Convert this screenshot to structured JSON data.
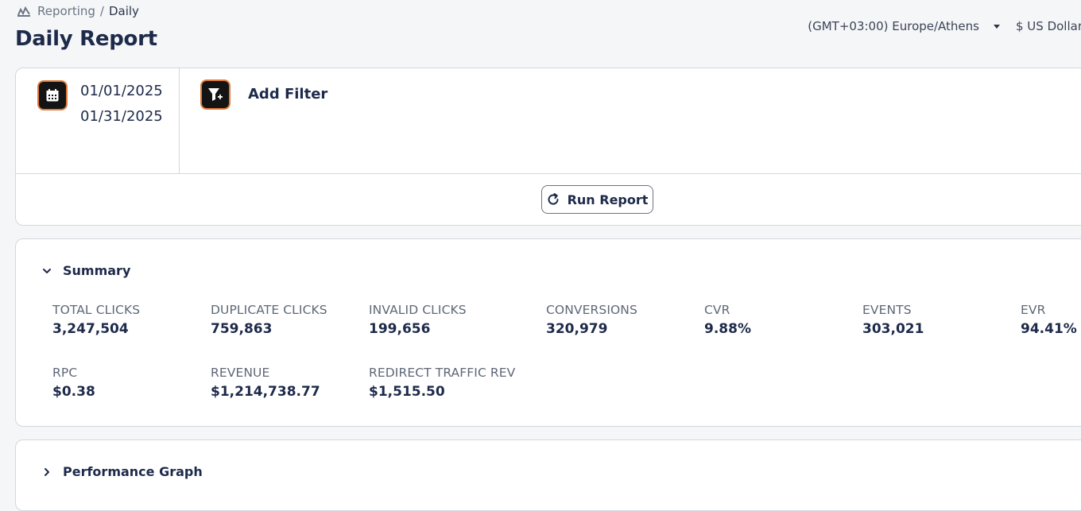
{
  "breadcrumb": {
    "parent": "Reporting",
    "separator": "/",
    "current": "Daily"
  },
  "page": {
    "title": "Daily Report"
  },
  "header": {
    "timezone": "(GMT+03:00) Europe/Athens",
    "currency": "$ US Dollar"
  },
  "filters": {
    "date_start": "01/01/2025",
    "date_end": "01/31/2025",
    "add_filter_label": "Add Filter",
    "run_report_label": "Run Report"
  },
  "summary": {
    "title": "Summary",
    "stats": [
      {
        "label": "TOTAL CLICKS",
        "value": "3,247,504"
      },
      {
        "label": "DUPLICATE CLICKS",
        "value": "759,863"
      },
      {
        "label": "INVALID CLICKS",
        "value": "199,656"
      },
      {
        "label": "CONVERSIONS",
        "value": "320,979"
      },
      {
        "label": "CVR",
        "value": "9.88%"
      },
      {
        "label": "EVENTS",
        "value": "303,021"
      },
      {
        "label": "EVR",
        "value": "94.41%"
      },
      {
        "label": "RPC",
        "value": "$0.38"
      },
      {
        "label": "REVENUE",
        "value": "$1,214,738.77"
      },
      {
        "label": "REDIRECT TRAFFIC REV",
        "value": "$1,515.50"
      }
    ]
  },
  "performance": {
    "title": "Performance Graph"
  },
  "colors": {
    "accent": "#e07b3a",
    "text": "#1d2a4a",
    "border": "#d3d7de"
  },
  "icons": [
    "reporting-icon",
    "calendar-icon",
    "filter-add-icon",
    "refresh-icon",
    "chevron-down-icon",
    "chevron-right-icon",
    "caret-down-icon"
  ]
}
